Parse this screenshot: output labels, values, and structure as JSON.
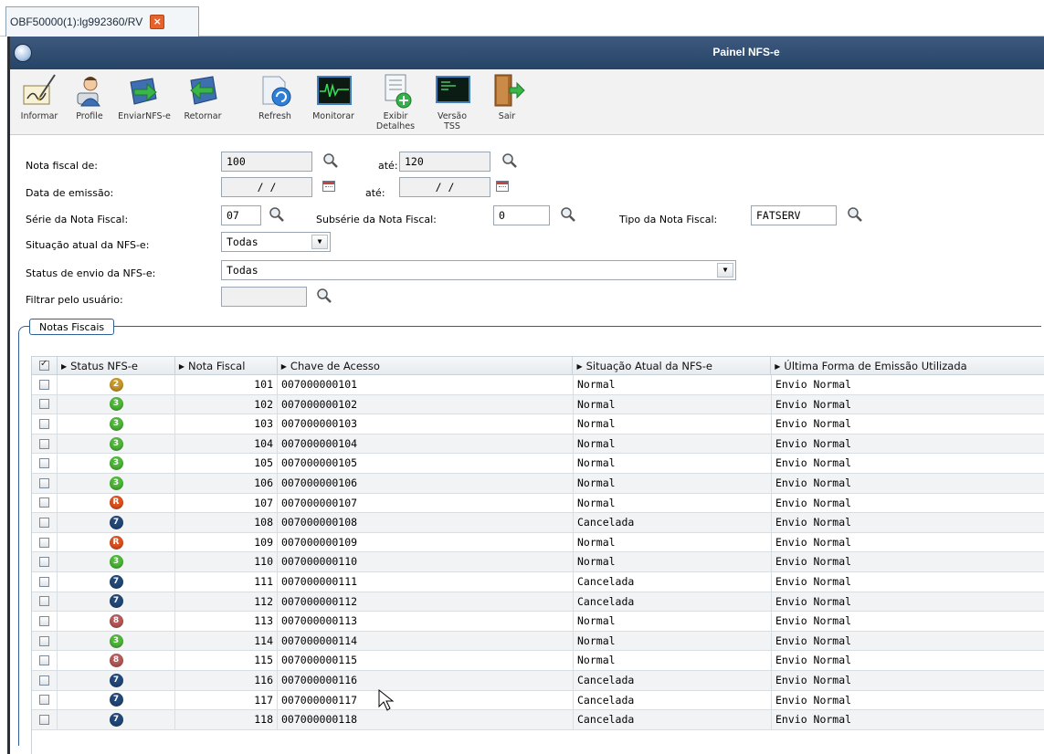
{
  "tab": {
    "label": "OBF50000(1):lg992360/RV",
    "close_glyph": "×"
  },
  "window": {
    "title": "Painel NFS-e"
  },
  "toolbar": {
    "items": [
      {
        "label": "Informar",
        "icon": "pen-paper-icon"
      },
      {
        "label": "Profile",
        "icon": "user-icon"
      },
      {
        "label": "EnviarNFS-e",
        "icon": "send-arrow-icon"
      },
      {
        "label": "Retornar",
        "icon": "return-arrow-icon"
      },
      {
        "label": "Refresh",
        "icon": "refresh-icon"
      },
      {
        "label": "Monitorar",
        "icon": "monitor-wave-icon"
      },
      {
        "label": "Exibir Detalhes",
        "icon": "details-add-icon"
      },
      {
        "label": "Versão TSS",
        "icon": "terminal-icon"
      },
      {
        "label": "Sair",
        "icon": "exit-door-icon"
      }
    ]
  },
  "filters": {
    "nota_fiscal_de": {
      "label": "Nota fiscal de:",
      "value": "100"
    },
    "nota_fiscal_ate": {
      "label": "até:",
      "value": "120"
    },
    "data_emissao_de": {
      "label": "Data de emissão:",
      "value": "/ /"
    },
    "data_emissao_ate": {
      "label": "até:",
      "value": "/ /"
    },
    "serie": {
      "label": "Série da Nota Fiscal:",
      "value": "07"
    },
    "subserie": {
      "label": "Subsérie da Nota Fiscal:",
      "value": "0"
    },
    "tipo": {
      "label": "Tipo da Nota Fiscal:",
      "value": "FATSERV"
    },
    "situacao": {
      "label": "Situação atual da NFS-e:",
      "value": "Todas"
    },
    "status_envio": {
      "label": "Status de envio da NFS-e:",
      "value": "Todas"
    },
    "usuario": {
      "label": "Filtrar pelo usuário:",
      "value": ""
    }
  },
  "group": {
    "title": "Notas Fiscais"
  },
  "grid": {
    "columns": [
      "Status NFS-e",
      "Nota Fiscal",
      "Chave de Acesso",
      "Situação Atual da NFS-e",
      "Última Forma de Emissão Utilizada"
    ],
    "status_colors": {
      "2": "#c9982b",
      "3": "#4fb83a",
      "R": "#e0531f",
      "7": "#22497a",
      "8": "#b85a5a"
    },
    "rows": [
      {
        "status": "2",
        "nota": "101",
        "chave": "007000000101",
        "situacao": "Normal",
        "forma": "Envio Normal"
      },
      {
        "status": "3",
        "nota": "102",
        "chave": "007000000102",
        "situacao": "Normal",
        "forma": "Envio Normal"
      },
      {
        "status": "3",
        "nota": "103",
        "chave": "007000000103",
        "situacao": "Normal",
        "forma": "Envio Normal"
      },
      {
        "status": "3",
        "nota": "104",
        "chave": "007000000104",
        "situacao": "Normal",
        "forma": "Envio Normal"
      },
      {
        "status": "3",
        "nota": "105",
        "chave": "007000000105",
        "situacao": "Normal",
        "forma": "Envio Normal"
      },
      {
        "status": "3",
        "nota": "106",
        "chave": "007000000106",
        "situacao": "Normal",
        "forma": "Envio Normal"
      },
      {
        "status": "R",
        "nota": "107",
        "chave": "007000000107",
        "situacao": "Normal",
        "forma": "Envio Normal"
      },
      {
        "status": "7",
        "nota": "108",
        "chave": "007000000108",
        "situacao": "Cancelada",
        "forma": "Envio Normal"
      },
      {
        "status": "R",
        "nota": "109",
        "chave": "007000000109",
        "situacao": "Normal",
        "forma": "Envio Normal"
      },
      {
        "status": "3",
        "nota": "110",
        "chave": "007000000110",
        "situacao": "Normal",
        "forma": "Envio Normal"
      },
      {
        "status": "7",
        "nota": "111",
        "chave": "007000000111",
        "situacao": "Cancelada",
        "forma": "Envio Normal"
      },
      {
        "status": "7",
        "nota": "112",
        "chave": "007000000112",
        "situacao": "Cancelada",
        "forma": "Envio Normal"
      },
      {
        "status": "8",
        "nota": "113",
        "chave": "007000000113",
        "situacao": "Normal",
        "forma": "Envio Normal"
      },
      {
        "status": "3",
        "nota": "114",
        "chave": "007000000114",
        "situacao": "Normal",
        "forma": "Envio Normal"
      },
      {
        "status": "8",
        "nota": "115",
        "chave": "007000000115",
        "situacao": "Normal",
        "forma": "Envio Normal"
      },
      {
        "status": "7",
        "nota": "116",
        "chave": "007000000116",
        "situacao": "Cancelada",
        "forma": "Envio Normal"
      },
      {
        "status": "7",
        "nota": "117",
        "chave": "007000000117",
        "situacao": "Cancelada",
        "forma": "Envio Normal"
      },
      {
        "status": "7",
        "nota": "118",
        "chave": "007000000118",
        "situacao": "Cancelada",
        "forma": "Envio Normal"
      }
    ]
  }
}
